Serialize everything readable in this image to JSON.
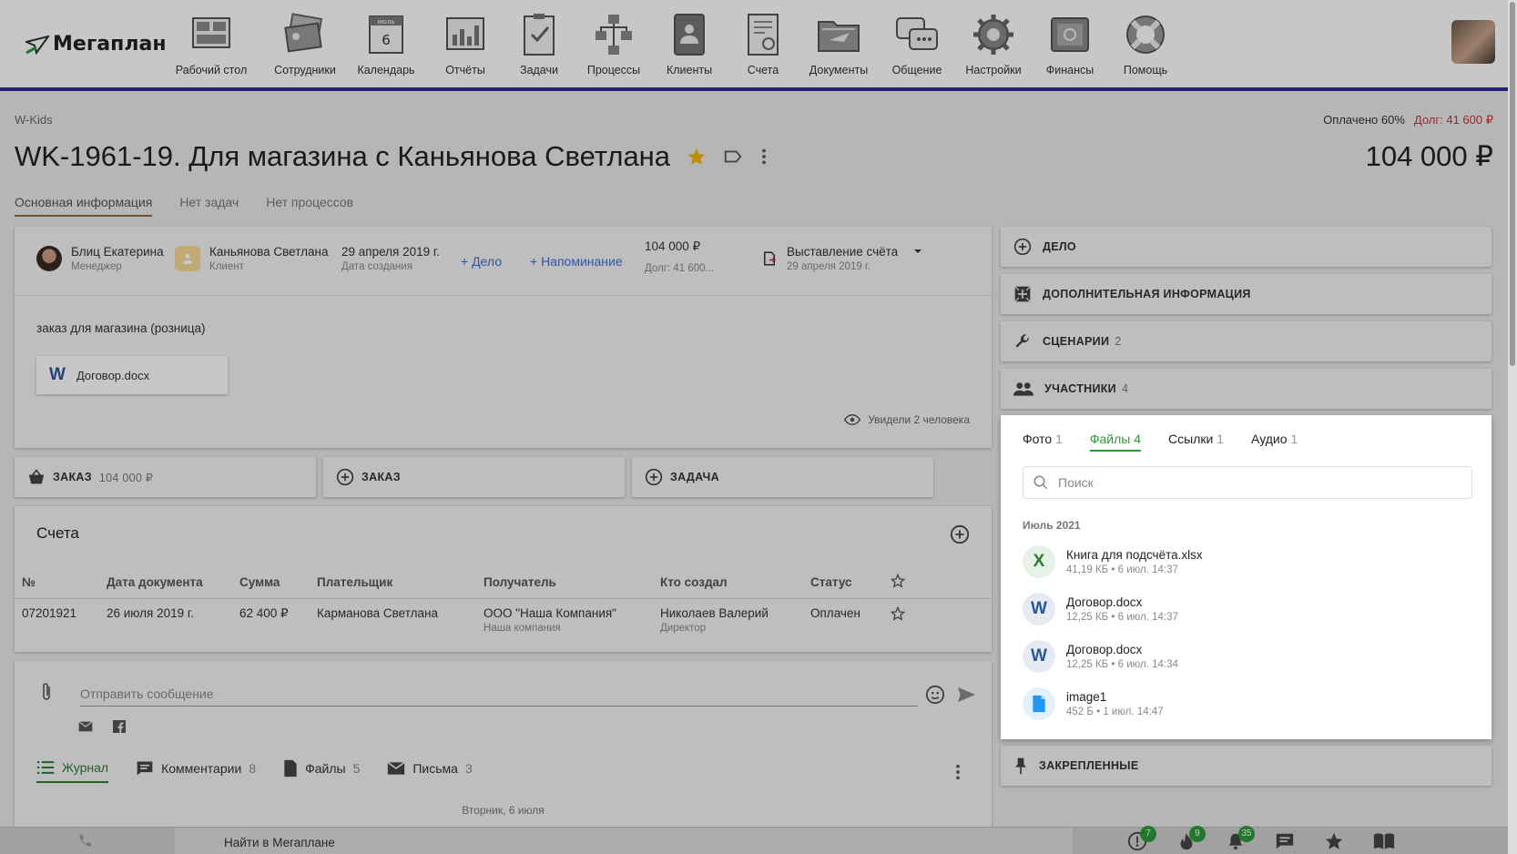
{
  "brand": {
    "name": "Мегаплан"
  },
  "nav": [
    {
      "label": "Рабочий стол",
      "icon": "desktop-icon"
    },
    {
      "label": "Сотрудники",
      "icon": "employees-icon"
    },
    {
      "label": "Календарь",
      "icon": "calendar-icon",
      "month": "июль",
      "day": "6"
    },
    {
      "label": "Отчёты",
      "icon": "reports-icon"
    },
    {
      "label": "Задачи",
      "icon": "tasks-icon"
    },
    {
      "label": "Процессы",
      "icon": "processes-icon"
    },
    {
      "label": "Клиенты",
      "icon": "clients-icon"
    },
    {
      "label": "Счета",
      "icon": "invoices-icon"
    },
    {
      "label": "Документы",
      "icon": "documents-icon"
    },
    {
      "label": "Общение",
      "icon": "chat-icon"
    },
    {
      "label": "Настройки",
      "icon": "settings-icon"
    },
    {
      "label": "Финансы",
      "icon": "finance-icon"
    },
    {
      "label": "Помощь",
      "icon": "help-icon"
    }
  ],
  "breadcrumb": "W-Kids",
  "payment": {
    "paid": "Оплачено 60%",
    "debt": "Долг: 41 600 ₽"
  },
  "deal": {
    "title": "WK-1961-19. Для магазина с Каньянова Светлана",
    "amount": "104 000 ₽"
  },
  "tabs": [
    "Основная информация",
    "Нет задач",
    "Нет процессов"
  ],
  "info": {
    "manager": {
      "name": "Блиц Екатерина",
      "role": "Менеджер"
    },
    "client": {
      "name": "Каньянова Светлана",
      "role": "Клиент"
    },
    "date": {
      "value": "29 апреля 2019 г.",
      "label": "Дата создания"
    },
    "add_case": "+ Дело",
    "add_reminder": "+ Напоминание",
    "sum": {
      "value": "104 000 ₽",
      "debt": "Долг: 41 600..."
    },
    "stage": {
      "value": "Выставление счёта",
      "date": "29 апреля 2019 г."
    },
    "description": "заказ для магазина (розница)",
    "file": "Договор.docx",
    "seen": "Увидели 2 человека"
  },
  "actions": [
    {
      "label": "ЗАКАЗ",
      "sub": "104 000 ₽",
      "icon": "basket-icon"
    },
    {
      "label": "ЗАКАЗ",
      "sub": "",
      "icon": "plus-circle-icon"
    },
    {
      "label": "ЗАДАЧА",
      "sub": "",
      "icon": "plus-circle-icon"
    }
  ],
  "bills": {
    "title": "Счета",
    "columns": [
      "№",
      "Дата документа",
      "Сумма",
      "Плательщик",
      "Получатель",
      "Кто создал",
      "Статус"
    ],
    "rows": [
      {
        "num": "07201921",
        "date": "26 июля 2019 г.",
        "sum": "62 400 ₽",
        "payer": "Карманова Светлана",
        "receiver": "ООО \"Наша Компания\"",
        "receiver_sub": "Наша компания",
        "creator": "Николаев Валерий",
        "creator_sub": "Директор",
        "status": "Оплачен"
      }
    ]
  },
  "message": {
    "placeholder": "Отправить сообщение",
    "tabs": [
      {
        "label": "Журнал",
        "count": ""
      },
      {
        "label": "Комментарии",
        "count": "8"
      },
      {
        "label": "Файлы",
        "count": "5"
      },
      {
        "label": "Письма",
        "count": "3"
      }
    ],
    "day": "Вторник, 6 июля"
  },
  "right": {
    "sections": [
      {
        "label": "ДЕЛО",
        "count": "",
        "icon": "plus-circle-icon"
      },
      {
        "label": "ДОПОЛНИТЕЛЬНАЯ ИНФОРМАЦИЯ",
        "count": "",
        "icon": "expand-icon"
      },
      {
        "label": "СЦЕНАРИИ",
        "count": "2",
        "icon": "wrench-icon"
      },
      {
        "label": "УЧАСТНИКИ",
        "count": "4",
        "icon": "people-icon"
      }
    ],
    "pinned": {
      "label": "ЗАКРЕПЛЕННЫЕ",
      "icon": "pin-icon"
    }
  },
  "files": {
    "tabs": [
      {
        "label": "Фото",
        "count": "1"
      },
      {
        "label": "Файлы",
        "count": "4"
      },
      {
        "label": "Ссылки",
        "count": "1"
      },
      {
        "label": "Аудио",
        "count": "1"
      }
    ],
    "search_placeholder": "Поиск",
    "month": "Июль 2021",
    "items": [
      {
        "name": "Книга для подсчёта.xlsx",
        "meta": "41,19 КБ • 6 июл. 14:37",
        "type": "X",
        "color": "#2e7d32",
        "bg": "#e6f1e7"
      },
      {
        "name": "Договор.docx",
        "meta": "12,25 КБ • 6 июл. 14:37",
        "type": "W",
        "color": "#2b579a",
        "bg": "#e6ebf3"
      },
      {
        "name": "Договор.docx",
        "meta": "12,25 КБ • 6 июл. 14:34",
        "type": "W",
        "color": "#2b579a",
        "bg": "#e6ebf3"
      },
      {
        "name": "image1",
        "meta": "452 Б • 1 июл. 14:47",
        "type": "file",
        "color": "#2196f3",
        "bg": "#e3f1fd"
      }
    ]
  },
  "bottom": {
    "search": "Найти в Мегаплане",
    "badges": [
      "7",
      "9",
      "35"
    ]
  },
  "colors": {
    "accent": "#2c2c9a",
    "green": "#2e9a3a",
    "link": "#3a6fd8",
    "debt": "#d32f2f"
  }
}
